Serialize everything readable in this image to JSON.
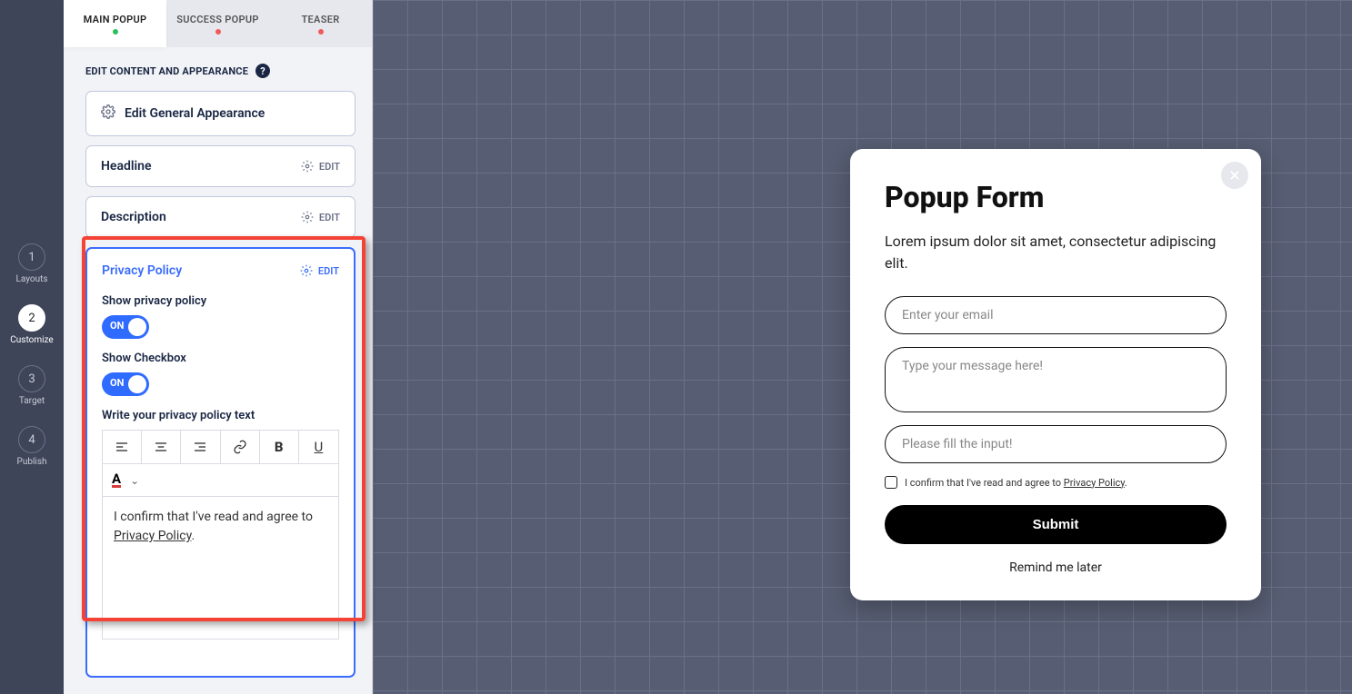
{
  "steps": [
    {
      "num": "1",
      "label": "Layouts"
    },
    {
      "num": "2",
      "label": "Customize"
    },
    {
      "num": "3",
      "label": "Target"
    },
    {
      "num": "4",
      "label": "Publish"
    }
  ],
  "tabs": [
    {
      "label": "MAIN POPUP",
      "dot": "#2bbf5a"
    },
    {
      "label": "SUCCESS POPUP",
      "dot": "#f05a5a"
    },
    {
      "label": "TEASER",
      "dot": "#f05a5a"
    }
  ],
  "sectionLabel": "EDIT CONTENT AND APPEARANCE",
  "cards": {
    "general": "Edit General Appearance",
    "headline": "Headline",
    "description": "Description",
    "editLabel": "EDIT"
  },
  "privacy": {
    "title": "Privacy Policy",
    "edit": "EDIT",
    "showPolicy": "Show privacy policy",
    "showCheckbox": "Show Checkbox",
    "toggleOn": "ON",
    "writeLabel": "Write your privacy policy text",
    "textPrefix": "I confirm that I've read and agree to ",
    "linkText": "Privacy Policy",
    "textSuffix": "."
  },
  "popup": {
    "title": "Popup Form",
    "desc": "Lorem ipsum dolor sit amet, consectetur adipiscing elit.",
    "emailPlaceholder": "Enter your email",
    "messagePlaceholder": "Type your message here!",
    "inputPlaceholder": "Please fill the input!",
    "consentPrefix": "I confirm that I've read and agree to ",
    "consentLink": "Privacy Policy",
    "consentSuffix": ".",
    "submit": "Submit",
    "remind": "Remind me later"
  }
}
